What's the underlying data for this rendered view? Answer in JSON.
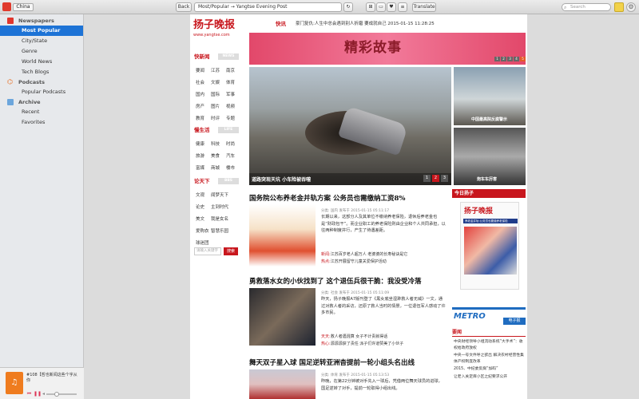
{
  "toolbar": {
    "country": "China",
    "back_label": "Back",
    "address": "Most/Popular  →  Yangtse Evening Post",
    "translate_label": "Translate",
    "search_placeholder": "Search"
  },
  "sidebar": {
    "sections": [
      {
        "title": "Newspapers",
        "items": [
          "Most Popular",
          "City/State",
          "Genre",
          "World News",
          "Tech Blogs"
        ]
      },
      {
        "title": "Podcasts",
        "items": [
          "Popular Podcasts"
        ]
      },
      {
        "title": "Archive",
        "items": [
          "Recent",
          "Favorites"
        ]
      }
    ],
    "selected": "Most Popular"
  },
  "player": {
    "track": "#108【哲也新闻这些个字从你"
  },
  "page": {
    "logo": "扬子晚报",
    "logo_url": "www.yangtse.com",
    "breaking_label": "快讯",
    "breaking_text": "豪门复仇:人生中总会遇到别人折磨 要成就自己    2015-01-15 11:28:25",
    "sections": [
      {
        "title": "快新闻",
        "tag": "NEWS",
        "items": [
          "要闻",
          "江苏",
          "南京",
          "社会",
          "文娱",
          "体育",
          "国内",
          "国际",
          "军事",
          "房产",
          "图片",
          "视频",
          "教育",
          "时评",
          "专题"
        ]
      },
      {
        "title": "慢生活",
        "tag": "LIFE",
        "items": [
          "健康",
          "科技",
          "时尚",
          "旅游",
          "美食",
          "汽车",
          "富媒",
          "商城",
          "楼市"
        ]
      },
      {
        "title": "论天下",
        "tag": "BBS",
        "items": [
          "文观",
          "闻梦天下",
          "论史",
          "主到时代",
          "美文",
          "我是女名",
          "爱购衣",
          "智慧乐园",
          "球迷团"
        ]
      }
    ],
    "search_placeholder": "请输入关键字",
    "search_button": "搜索",
    "banner_title": "精彩故事",
    "banner_dots": [
      "1",
      "2",
      "3",
      "4",
      "5"
    ],
    "main_photo_caption": "道路突现天坑 小车险被吞噬",
    "photo_pages": [
      "1",
      "2",
      "3"
    ],
    "side_photos": [
      {
        "caption": "中国最高院反腐警示"
      },
      {
        "caption": "炮车车厉害"
      }
    ],
    "articles": [
      {
        "title": "国务院公布养老金并轨方案 公务员也需缴纳工资8%",
        "meta": "分类: 国内  发布于 2015-01-15 05:11:17",
        "body": "长期以来，这部分人及其单位不缴纳养老保险，退休后养老金也是“财政包干”。而企业职工的养老保险则由企业和个人共同承担，以往两种制度并行，产生了待遇差距。",
        "related": [
          {
            "label": "新闻:",
            "text": "江苏百岁老人超万人 老婆婆的长寿秘诀是它"
          },
          {
            "label": "热点:",
            "text": "江苏开展留守儿童关爱保护活动"
          }
        ]
      },
      {
        "title": "勇救落水女的小伙找到了 这个退伍兵很干脆：我没受冷落",
        "meta": "分类: 社会  发布于 2015-01-15 05:11:09",
        "body": "昨天，扬子晚报A7版刊登了《黑女底坐湿渺救人者无威》一文，通过对救人者的采访，还原了救人当时的情景，一位退伍军人感动了许多市民。",
        "related": [
          {
            "label": "天天:",
            "text": "救人者遇混算 女子不计责就得话"
          },
          {
            "label": "热心:",
            "text": "源源源获了责任 派子们许道赞美了小伙子"
          }
        ]
      },
      {
        "title": "舞天双子星入球 国足逆转亚洲杳提前一轮小组头名出线",
        "meta": "分类: 体育  发布于 2015-01-15 05:13:53",
        "body": "昨晚，在第22分钟被对手先入一球后，凭借两位舞天球员的进球，国足逆转了对手，提前一轮取得小组出线。",
        "related": []
      }
    ],
    "today_label": "今日扬子",
    "paper_head": "扬子晚报",
    "paper_strip": "养老金并轨:公务员也要缴养老保险",
    "metro_logo": "METRO",
    "metro_tag": "电子报",
    "right_news_title": "要闻",
    "right_news": [
      "中央财经领导小组流动系统“大手术”：收权给政府放权",
      "中央一号文件呼之欲出 解决农村经营性集体产权制度改革",
      "2015、中纪委反腐“加码”",
      "让老入关定库小区之纪要求公开"
    ]
  },
  "colors": {
    "brand_red": "#c8161d",
    "selection_blue": "#1d73d6",
    "sidebar_bg": "#e7e9ec"
  }
}
